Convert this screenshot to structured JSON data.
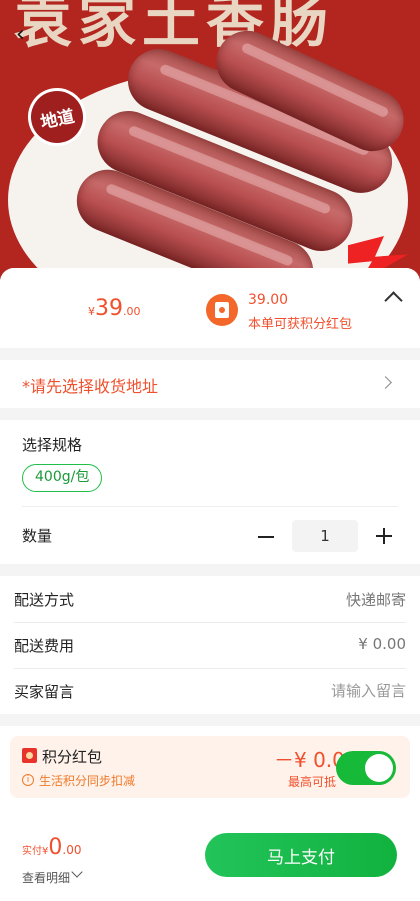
{
  "hero": {
    "banner_text": "袁家土香肠",
    "seal_text": "地道"
  },
  "summary": {
    "price_symbol": "¥",
    "price_int": "39",
    "price_dec": ".00",
    "hongbao_amount": "39.00",
    "hongbao_note": "本单可获积分红包"
  },
  "address": {
    "prompt": "*请先选择收货地址"
  },
  "spec": {
    "title": "选择规格",
    "selected_option": "400g/包",
    "quantity_label": "数量",
    "quantity": "1"
  },
  "delivery": {
    "method_label": "配送方式",
    "method_value": "快递邮寄",
    "fee_label": "配送费用",
    "fee_value": "¥ 0.00",
    "message_label": "买家留言",
    "message_placeholder": "请输入留言"
  },
  "points": {
    "title": "积分红包",
    "desc": "生活积分同步扣减",
    "amount": "－¥ 0.00",
    "sub": "最高可抵",
    "enabled": true
  },
  "footer": {
    "paid_label": "实付",
    "paid_symbol": "¥",
    "paid_int": "0",
    "paid_dec": ".00",
    "detail_label": "查看明细",
    "pay_button": "马上支付"
  },
  "colors": {
    "accent_red": "#f0502d",
    "accent_green": "#17b938"
  }
}
